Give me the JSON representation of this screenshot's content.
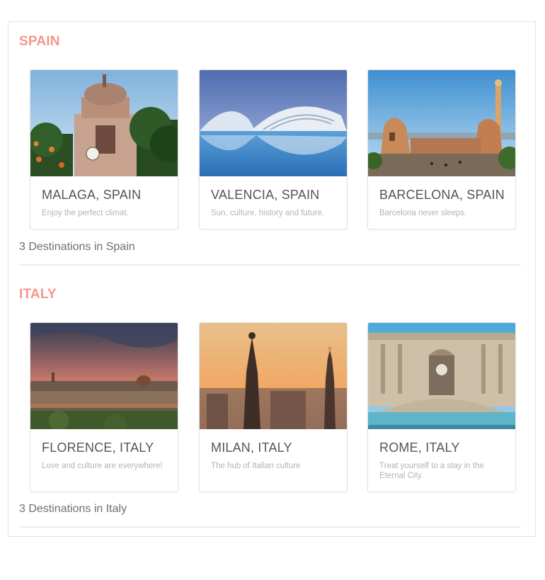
{
  "sections": [
    {
      "title": "SPAIN",
      "count_text": "3 Destinations in Spain",
      "cards": [
        {
          "title": "MALAGA, SPAIN",
          "description": "Enjoy the perfect climat."
        },
        {
          "title": "VALENCIA, SPAIN",
          "description": "Sun, culture, history and future."
        },
        {
          "title": "BARCELONA, SPAIN",
          "description": "Barcelona never sleeps."
        }
      ]
    },
    {
      "title": "ITALY",
      "count_text": "3 Destinations in Italy",
      "cards": [
        {
          "title": "FLORENCE, ITALY",
          "description": "Love and culture are everywhere!"
        },
        {
          "title": "MILAN, ITALY",
          "description": "The hub of Italian culture"
        },
        {
          "title": "ROME, ITALY",
          "description": "Treat yourself to a stay in the Eternal City."
        }
      ]
    }
  ],
  "colors": {
    "section_title": "#f4978c",
    "card_title": "#555555",
    "card_description": "#b3b3b3",
    "count_text": "#6f6f6f"
  }
}
